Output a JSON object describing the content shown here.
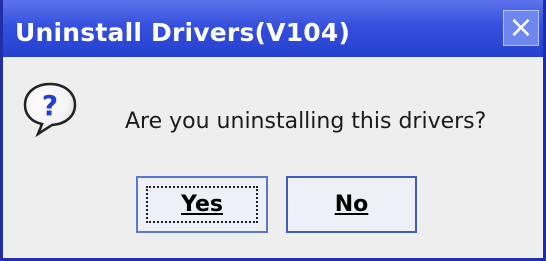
{
  "window": {
    "title": "Uninstall Drivers(V104)",
    "close_glyph": "×"
  },
  "dialog": {
    "icon": "question-icon",
    "message": "Are you uninstalling this drivers?"
  },
  "buttons": {
    "yes_label": "Yes",
    "no_label": "No"
  },
  "colors": {
    "titlebar": "#3550dd",
    "border": "#1e2fa8",
    "body": "#eeeeee"
  }
}
